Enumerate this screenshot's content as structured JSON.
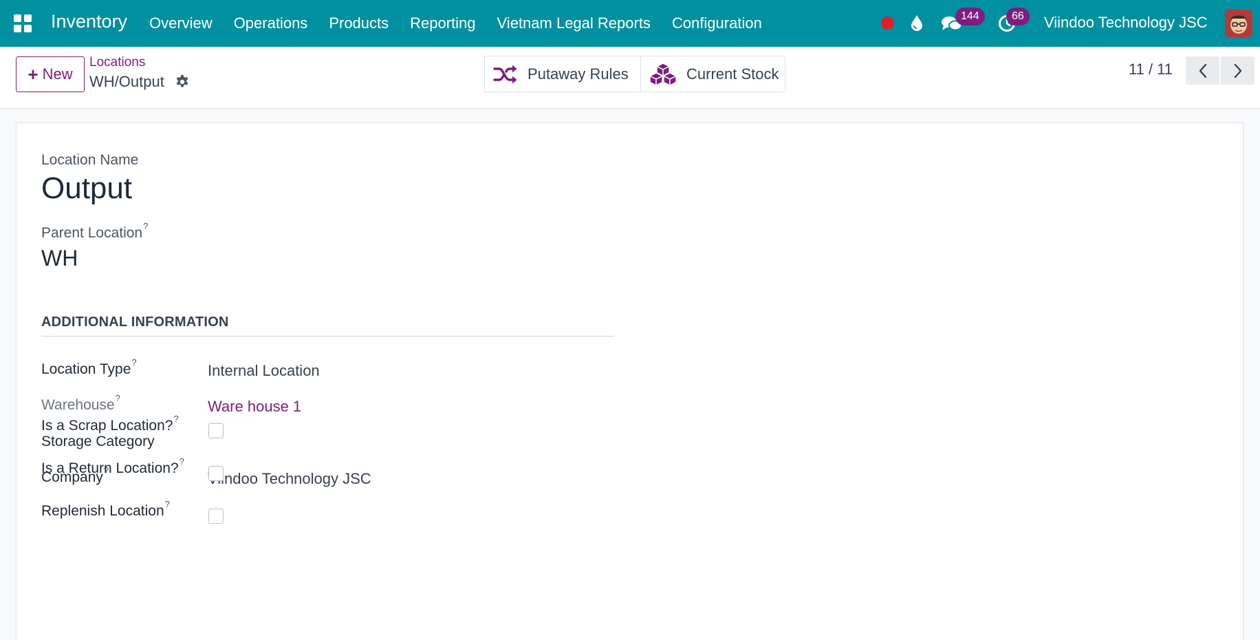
{
  "navbar": {
    "app_name": "Inventory",
    "menu": [
      "Overview",
      "Operations",
      "Products",
      "Reporting",
      "Vietnam Legal Reports",
      "Configuration"
    ],
    "messages_count": "144",
    "activities_count": "66",
    "company": "Viindoo Technology JSC",
    "bg_color": "#01909f"
  },
  "control": {
    "new_label": "New",
    "breadcrumb_parent": "Locations",
    "breadcrumb_current": "WH/Output",
    "smart_buttons": {
      "putaway": "Putaway Rules",
      "stock": "Current Stock"
    },
    "pager": "11 / 11",
    "accent_color": "#7d1d7f"
  },
  "form": {
    "name_label": "Location Name",
    "name_value": "Output",
    "parent_label": "Parent Location",
    "parent_value": "WH",
    "help_mark": "?",
    "section_title": "ADDITIONAL INFORMATION",
    "fields": {
      "location_type": {
        "label": "Location Type",
        "value": "Internal Location"
      },
      "warehouse": {
        "label": "Warehouse",
        "value": "Ware house 1"
      },
      "storage_category": {
        "label": "Storage Category",
        "value": ""
      },
      "company": {
        "label": "Company",
        "value": "Viindoo Technology JSC"
      },
      "scrap": {
        "label": "Is a Scrap Location?",
        "checked": false
      },
      "return": {
        "label": "Is a Return Location?",
        "checked": false
      },
      "replenish": {
        "label": "Replenish Location",
        "checked": false
      }
    }
  }
}
